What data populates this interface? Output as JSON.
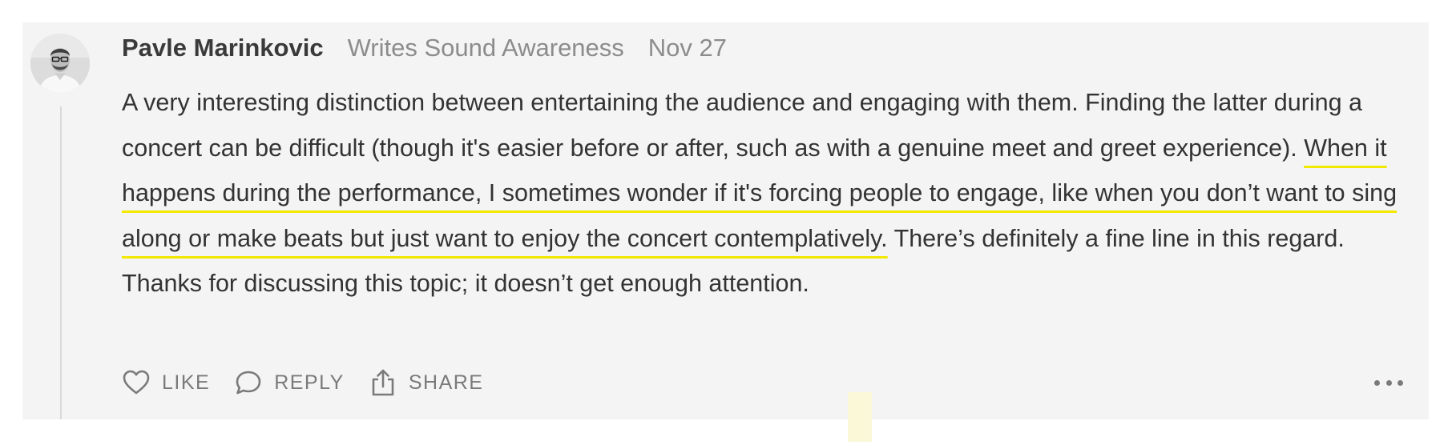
{
  "comment": {
    "author": {
      "name": "Pavle Marinkovic",
      "publication": "Writes Sound Awareness",
      "avatar_icon": "user-avatar-photo"
    },
    "date": "Nov 27",
    "body": {
      "before_highlight": "A very interesting distinction between entertaining the audience and engaging with them. Finding the latter during a concert can be difficult (though it's easier before or after, such as with a genuine meet and greet experience). ",
      "highlighted": "When it happens during the performance, I sometimes wonder if it's forcing people to engage, like when you don’t want to sing along or make beats but just want to enjoy the concert contemplatively.",
      "after_highlight": " There’s definitely a fine line in this regard. Thanks for discussing this topic; it doesn’t get enough attention."
    },
    "highlight_color": "#f2e800",
    "actions": {
      "like": {
        "label": "LIKE",
        "icon": "heart-icon"
      },
      "reply": {
        "label": "REPLY",
        "icon": "speech-bubble-icon"
      },
      "share": {
        "label": "SHARE",
        "icon": "share-icon"
      },
      "more": {
        "icon": "more-horizontal-icon"
      }
    }
  }
}
